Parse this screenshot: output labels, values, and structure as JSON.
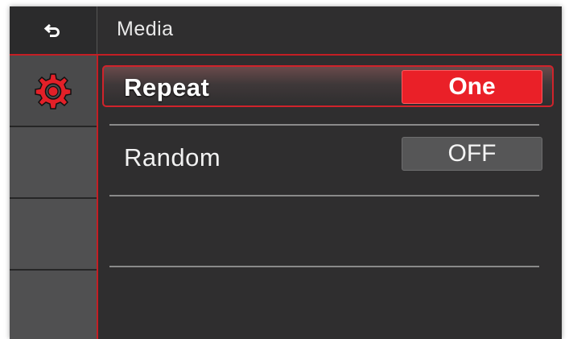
{
  "header": {
    "back_icon": "back-arrow-icon",
    "title": "Media"
  },
  "sidebar": {
    "tabs": [
      {
        "icon": "gear-icon",
        "active": true,
        "icon_color": "#e32028"
      },
      {
        "active": false
      },
      {
        "active": false
      },
      {
        "active": false
      }
    ]
  },
  "settings": [
    {
      "label": "Repeat",
      "value": "One",
      "state": "selected"
    },
    {
      "label": "Random",
      "value": "OFF",
      "state": "normal"
    }
  ],
  "colors": {
    "accent": "#e32028",
    "background": "#2f2e2f",
    "sidebar": "#515152"
  }
}
